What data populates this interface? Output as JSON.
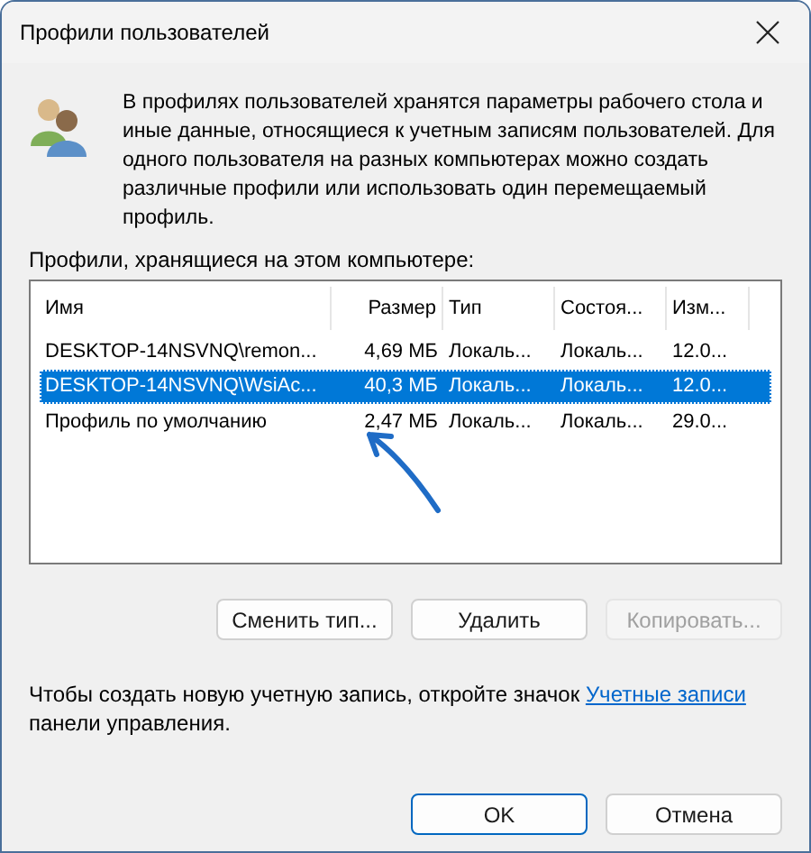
{
  "window": {
    "title": "Профили пользователей"
  },
  "description": "В профилях пользователей хранятся параметры рабочего стола и иные данные, относящиеся к учетным записям пользователей. Для одного пользователя на разных компьютерах можно создать различные профили или использовать один перемещаемый профиль.",
  "list_label": "Профили, хранящиеся на этом компьютере:",
  "table": {
    "columns": [
      {
        "label": "Имя"
      },
      {
        "label": "Размер"
      },
      {
        "label": "Тип"
      },
      {
        "label": "Состоя..."
      },
      {
        "label": "Изм..."
      }
    ],
    "rows": [
      {
        "cells": [
          "DESKTOP-14NSVNQ\\remon...",
          "4,69 МБ",
          "Локаль...",
          "Локаль...",
          "12.0..."
        ],
        "selected": false
      },
      {
        "cells": [
          "DESKTOP-14NSVNQ\\WsiAc...",
          "40,3 МБ",
          "Локаль...",
          "Локаль...",
          "12.0..."
        ],
        "selected": true
      },
      {
        "cells": [
          "Профиль по умолчанию",
          "2,47 МБ",
          "Локаль...",
          "Локаль...",
          "29.0..."
        ],
        "selected": false
      }
    ]
  },
  "buttons": [
    {
      "label": "Сменить тип...",
      "disabled": false
    },
    {
      "label": "Удалить",
      "disabled": false
    },
    {
      "label": "Копировать...",
      "disabled": true
    }
  ],
  "footer": {
    "text": "Чтобы создать новую учетную запись, откройте значок",
    "link": "Учетные записи",
    "text_after": "панели управления."
  },
  "dialog_buttons": [
    {
      "label": "OK",
      "default": true
    },
    {
      "label": "Отмена",
      "default": false
    }
  ]
}
